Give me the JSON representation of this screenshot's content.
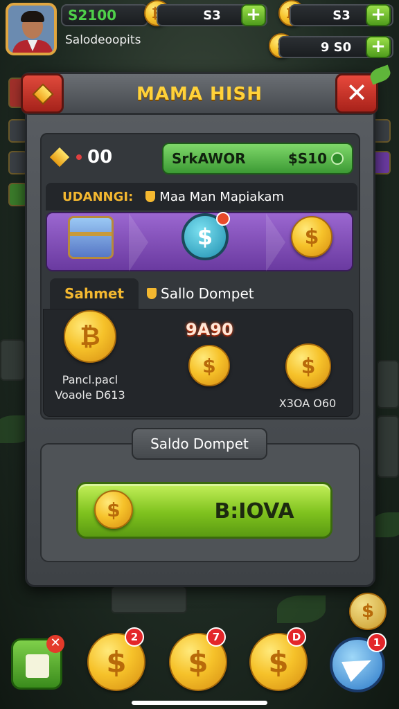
{
  "hud": {
    "player_name": "Salodeoopits",
    "cash": "S2100",
    "bar2_value": "S3",
    "bar3_value": "S3",
    "bar4_value": "9  S0"
  },
  "modal": {
    "title": "MAMA HISH",
    "gem_value": "00",
    "green_pill_label": "SrkAWOR",
    "green_pill_value": "$S10",
    "tab_a": "UDANNGI:",
    "tab_b": "Maa Man Mapiakam",
    "sub_tab_active": "Sahmet",
    "sub_tab_inactive": "Sallo Dompet",
    "coin_left_label_1": "Pancl.pacl",
    "coin_left_label_2": "Voaole D613",
    "coin_mid_value": "9A90",
    "coin_right_label": "X3OA O60",
    "wallet_label": "Saldo Dompet",
    "action_button": "B:IOVA"
  },
  "bottom_bar": {
    "badges": [
      "2",
      "7",
      "D",
      "1"
    ]
  },
  "icons": {
    "coin_symbol": "$",
    "bitcoin_symbol": "₿",
    "close_symbol": "✕",
    "plus_symbol": "+"
  },
  "colors": {
    "accent_gold": "#f4b830",
    "cash_green": "#4fd14a",
    "button_green": "#7fc21e",
    "close_red": "#e8493c",
    "track_purple": "#9b67d0"
  }
}
